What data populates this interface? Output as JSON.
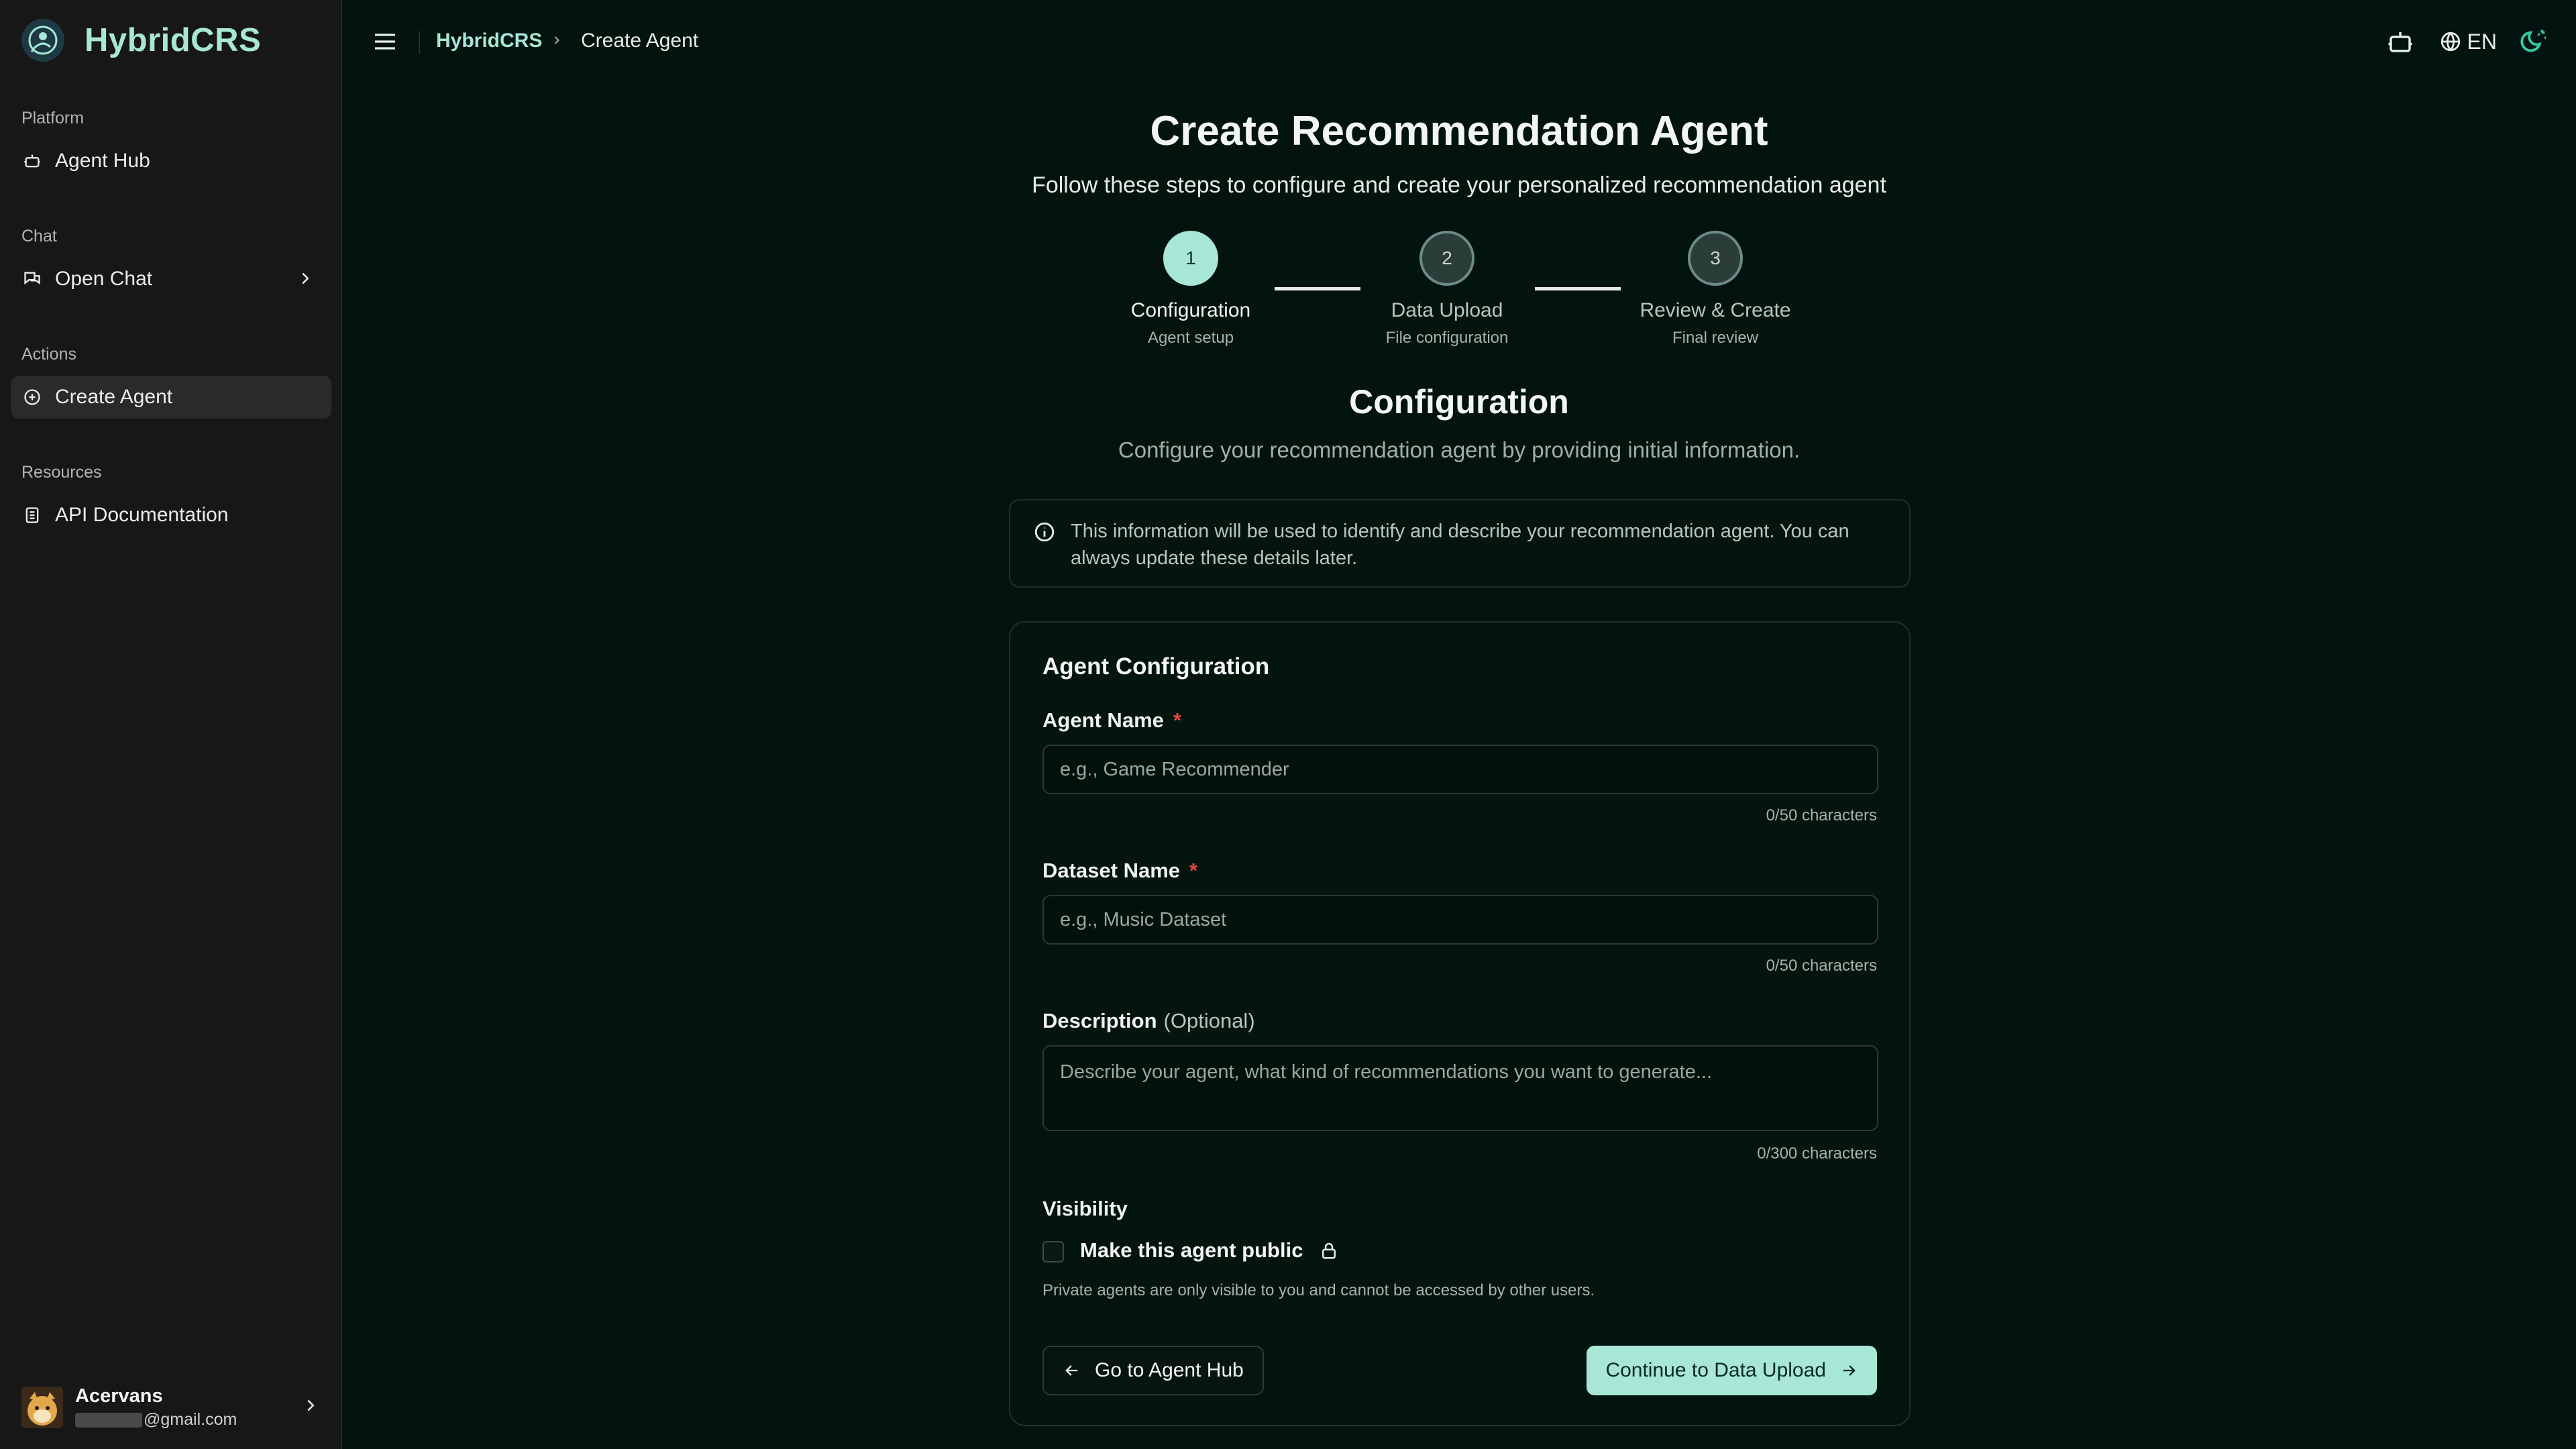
{
  "app": {
    "name": "HybridCRS",
    "accent_color": "#a8e6d5",
    "background_color": "#03130f"
  },
  "sidebar": {
    "groups": [
      {
        "label": "Platform",
        "items": [
          {
            "label": "Agent Hub",
            "icon": "bot-icon"
          }
        ]
      },
      {
        "label": "Chat",
        "items": [
          {
            "label": "Open Chat",
            "icon": "chat-icon",
            "expandable": true
          }
        ]
      },
      {
        "label": "Actions",
        "items": [
          {
            "label": "Create Agent",
            "icon": "plus-circle-icon",
            "active": true
          }
        ]
      },
      {
        "label": "Resources",
        "items": [
          {
            "label": "API Documentation",
            "icon": "document-icon"
          }
        ]
      }
    ],
    "user": {
      "name": "Acervans",
      "email_suffix": "@gmail.com"
    }
  },
  "header": {
    "breadcrumb": {
      "root": "HybridCRS",
      "current": "Create Agent"
    },
    "language": "EN"
  },
  "page": {
    "title": "Create Recommendation Agent",
    "subtitle": "Follow these steps to configure and create your personalized recommendation agent"
  },
  "steps": [
    {
      "number": "1",
      "label": "Configuration",
      "sub": "Agent setup",
      "status": "current"
    },
    {
      "number": "2",
      "label": "Data Upload",
      "sub": "File configuration",
      "status": "pending"
    },
    {
      "number": "3",
      "label": "Review & Create",
      "sub": "Final review",
      "status": "pending"
    }
  ],
  "section": {
    "title": "Configuration",
    "subtitle": "Configure your recommendation agent by providing initial information.",
    "info": "This information will be used to identify and describe your recommendation agent. You can always update these details later."
  },
  "form": {
    "card_title": "Agent Configuration",
    "agent_name": {
      "label": "Agent Name",
      "required_mark": "*",
      "placeholder": "e.g., Game Recommender",
      "value": "",
      "counter": "0/50 characters"
    },
    "dataset_name": {
      "label": "Dataset Name",
      "required_mark": "*",
      "placeholder": "e.g., Music Dataset",
      "value": "",
      "counter": "0/50 characters"
    },
    "description": {
      "label": "Description",
      "optional": "(Optional)",
      "placeholder": "Describe your agent, what kind of recommendations you want to generate...",
      "value": "",
      "counter": "0/300 characters"
    },
    "visibility": {
      "label": "Visibility",
      "checkbox_label": "Make this agent public",
      "checked": false,
      "note": "Private agents are only visible to you and cannot be accessed by other users."
    },
    "back_button": "Go to Agent Hub",
    "next_button": "Continue to Data Upload"
  }
}
